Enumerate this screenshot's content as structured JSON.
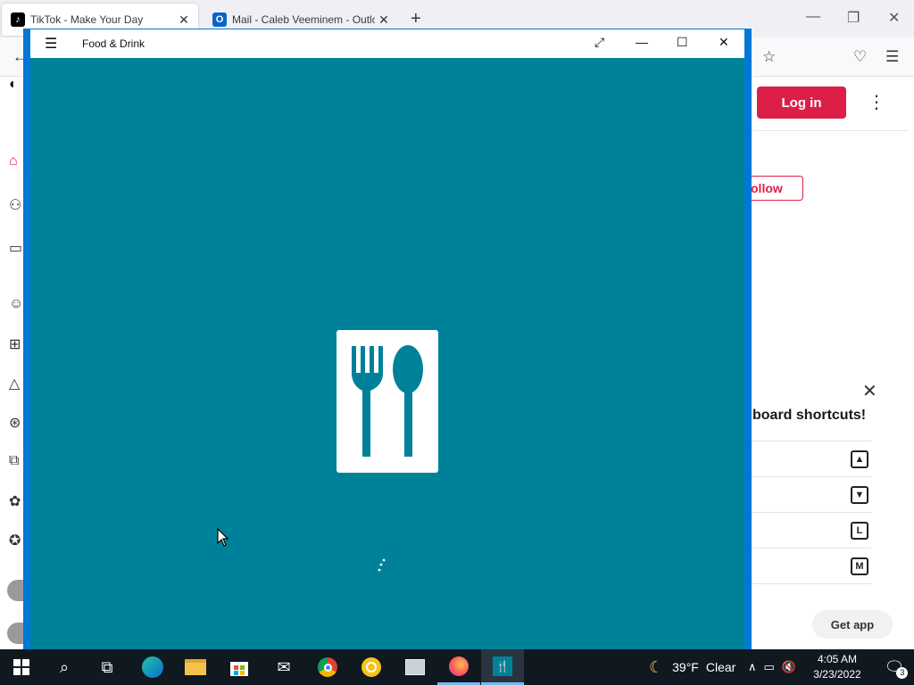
{
  "browser": {
    "tabs": [
      {
        "title": "TikTok - Make Your Day",
        "active": true,
        "favicon": "tiktok-icon"
      },
      {
        "title": "Mail - Caleb Veeminem - Outlo",
        "active": false,
        "favicon": "outlook-icon"
      }
    ],
    "new_tab_symbol": "+",
    "close_symbol": "✕"
  },
  "tiktok": {
    "login_label": "Log in",
    "follow_label": "ollow",
    "keyboard_title": "board shortcuts!",
    "shortcut_keys": [
      "▲",
      "▼",
      "L",
      "M"
    ],
    "get_app_label": "Get app",
    "accent_color": "#dd1f48"
  },
  "app_window": {
    "title": "Food & Drink",
    "background_color": "#00819a",
    "frame_color": "#0078d7"
  },
  "taskbar": {
    "weather": {
      "temperature": "39°F",
      "condition": "Clear"
    },
    "clock": {
      "time": "4:05 AM",
      "date": "3/23/2022"
    },
    "notification_count": "3",
    "pinned": [
      "start-icon",
      "search-icon",
      "task-view-icon",
      "edge-icon",
      "file-explorer-icon",
      "store-icon",
      "mail-icon",
      "chrome-icon",
      "norton-icon",
      "photos-icon",
      "firefox-icon",
      "food-drink-icon"
    ]
  }
}
